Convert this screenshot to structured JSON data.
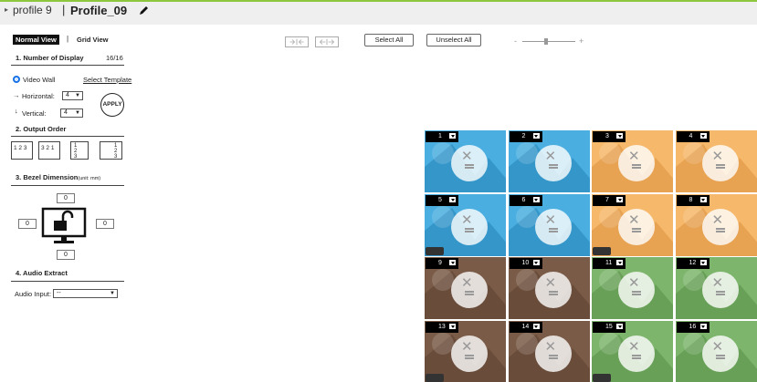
{
  "header": {
    "profile_label": "profile 9",
    "separator": "|",
    "profile_name": "Profile_09"
  },
  "views": {
    "normal": "Normal View",
    "separator": "|",
    "grid": "Grid View"
  },
  "sections": {
    "num_display": {
      "title": "1.  Number of Display",
      "count": "16/16"
    },
    "video_wall": "Video Wall",
    "select_template": "Select Template",
    "horizontal_label": "Horizontal:",
    "horizontal_value": "4",
    "vertical_label": "Vertical:",
    "vertical_value": "4",
    "apply": "APPLY",
    "output_order": {
      "title": "2.  Output Order"
    },
    "bezel": {
      "title": "3.  Bezel Dimension",
      "unit": "(unit: mm)",
      "top": "0",
      "left": "0",
      "right": "0",
      "bottom": "0"
    },
    "audio": {
      "title": "4.  Audio Extract",
      "label": "Audio Input:",
      "value": "--"
    }
  },
  "order_options": [
    {
      "text": "1 2 3"
    },
    {
      "text": "3 2 1"
    },
    {
      "text": "1 2 3"
    },
    {
      "text": "1 2 3"
    }
  ],
  "toolbar": {
    "select_all": "Select All",
    "unselect_all": "Unselect All",
    "zoom_minus": "-",
    "zoom_plus": "+",
    "zoom_level": 0.45
  },
  "screens": [
    {
      "num": "1",
      "color": "#4aaee0",
      "shade": "#3597c9",
      "audio": false
    },
    {
      "num": "2",
      "color": "#4aaee0",
      "shade": "#3597c9",
      "audio": false
    },
    {
      "num": "3",
      "color": "#f6b86a",
      "shade": "#e7a252",
      "audio": false
    },
    {
      "num": "4",
      "color": "#f6b86a",
      "shade": "#e7a252",
      "audio": false
    },
    {
      "num": "5",
      "color": "#4aaee0",
      "shade": "#3597c9",
      "audio": true
    },
    {
      "num": "6",
      "color": "#4aaee0",
      "shade": "#3597c9",
      "audio": false
    },
    {
      "num": "7",
      "color": "#f6b86a",
      "shade": "#e7a252",
      "audio": true
    },
    {
      "num": "8",
      "color": "#f6b86a",
      "shade": "#e7a252",
      "audio": false
    },
    {
      "num": "9",
      "color": "#7a5b47",
      "shade": "#6a4c3a",
      "audio": false
    },
    {
      "num": "10",
      "color": "#7a5b47",
      "shade": "#6a4c3a",
      "audio": false
    },
    {
      "num": "11",
      "color": "#7db56d",
      "shade": "#68a058",
      "audio": false
    },
    {
      "num": "12",
      "color": "#7db56d",
      "shade": "#68a058",
      "audio": false
    },
    {
      "num": "13",
      "color": "#7a5b47",
      "shade": "#6a4c3a",
      "audio": true
    },
    {
      "num": "14",
      "color": "#7a5b47",
      "shade": "#6a4c3a",
      "audio": false
    },
    {
      "num": "15",
      "color": "#7db56d",
      "shade": "#68a058",
      "audio": true
    },
    {
      "num": "16",
      "color": "#7db56d",
      "shade": "#68a058",
      "audio": false
    }
  ],
  "icons": {
    "header": "pencil-icon",
    "toolbar": [
      "expand-horizontal-icon",
      "collapse-horizontal-icon"
    ],
    "bezel": "monitor-unlock-icon"
  }
}
